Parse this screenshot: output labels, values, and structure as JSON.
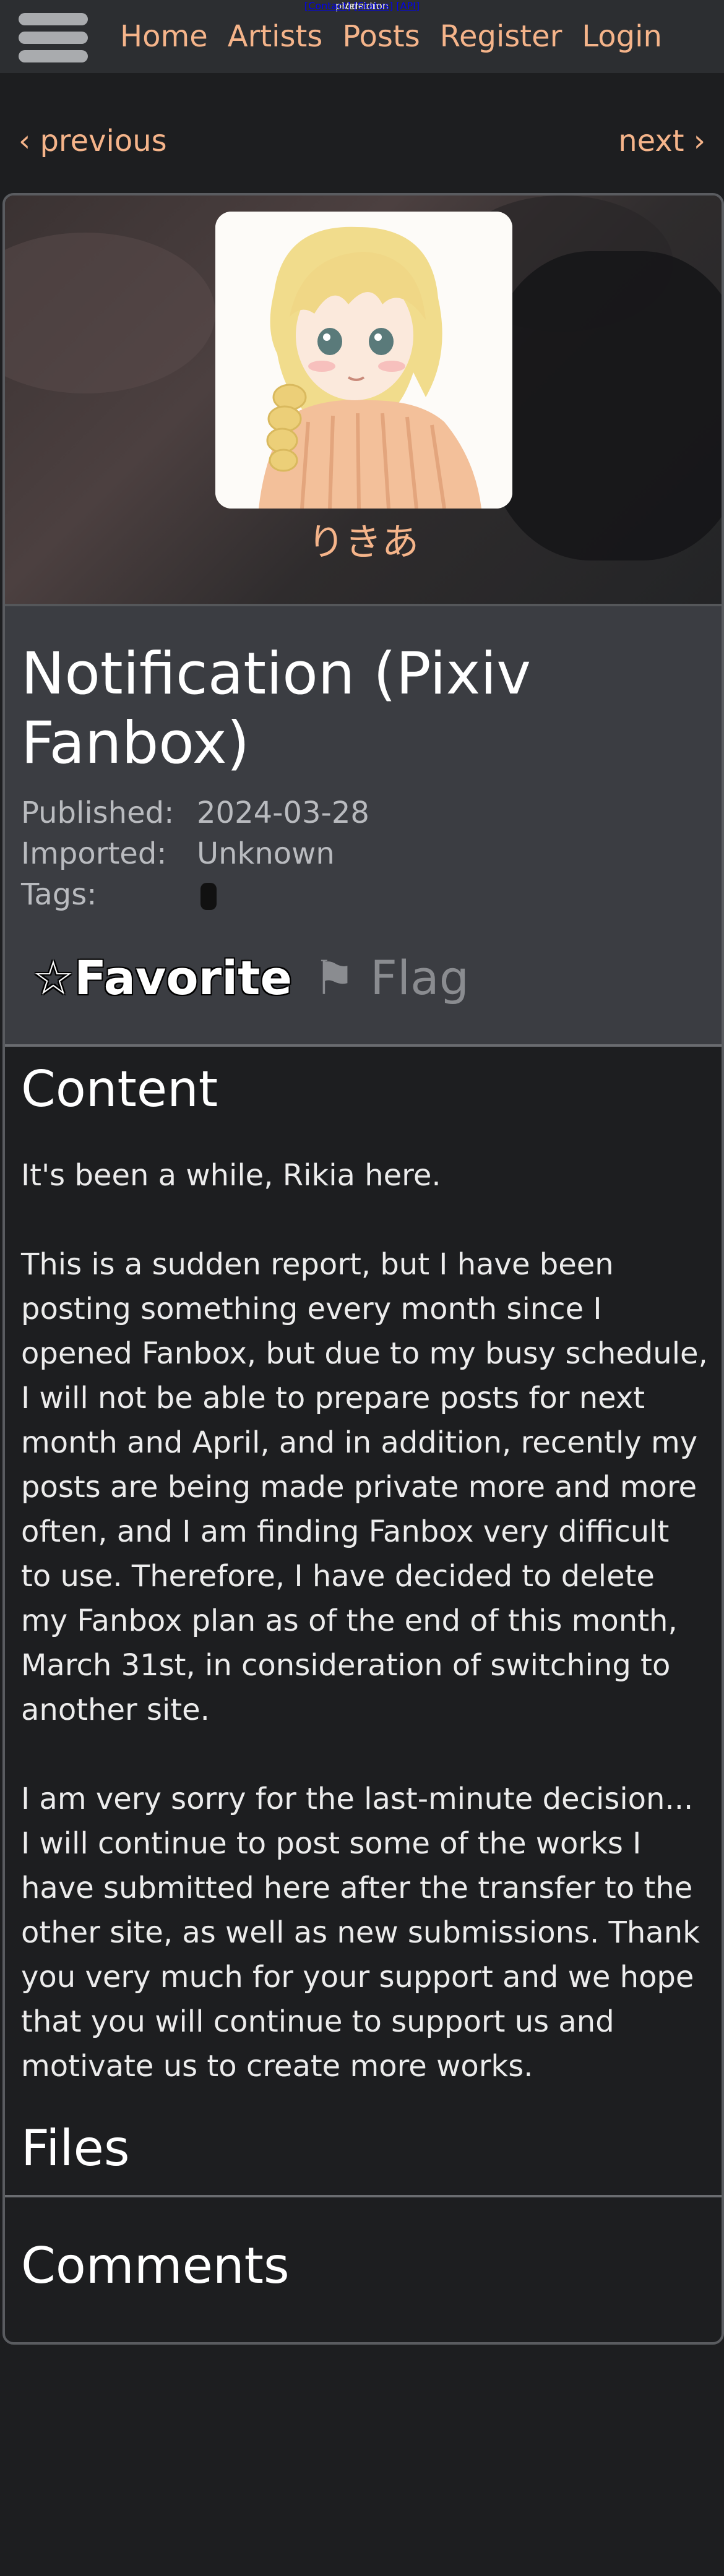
{
  "nav": {
    "links": [
      "Home",
      "Artists",
      "Posts",
      "Register",
      "Login"
    ]
  },
  "pager": {
    "previous": "‹ previous",
    "next": "next ›"
  },
  "artist": {
    "name": "りきあ"
  },
  "post": {
    "title": "Notification (Pixiv Fanbox)",
    "published_label": "Published:",
    "published_value": "2024-03-28",
    "imported_label": "Imported:",
    "imported_value": "Unknown",
    "tags_label": "Tags:",
    "favorite_label": "☆Favorite",
    "flag_label": "⚑ Flag"
  },
  "content": {
    "heading": "Content",
    "paragraphs": [
      "It's been a while, Rikia here.",
      "This is a sudden report, but I have been posting something every month since I opened Fanbox, but due to my busy schedule, I will not be able to prepare posts for next month and April, and in addition, recently my posts are being made private more and more often, and I am finding Fanbox very difficult to use. Therefore, I have decided to delete my Fanbox plan as of the end of this month, March 31st, in consideration of switching to another site.",
      "I am very sorry for the last-minute decision... I will continue to post some of the works I have submitted here after the transfer to the other site, as well as new submissions. Thank you very much for your support and we hope that you will continue to support us and motivate us to create more works."
    ]
  },
  "files": {
    "heading": "Files"
  },
  "comments": {
    "heading": "Comments"
  },
  "footer": {
    "version_label": "Version:",
    "version_value": "production",
    "links": [
      "[Contact]",
      "[Status]",
      "[API]"
    ]
  }
}
